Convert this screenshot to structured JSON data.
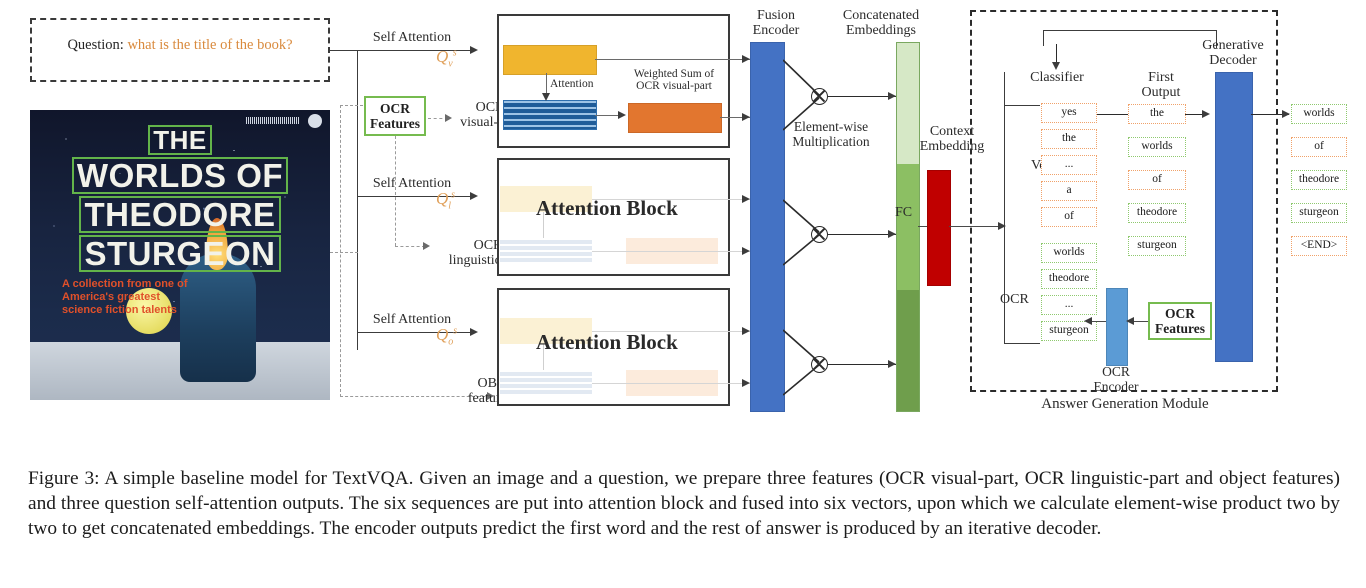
{
  "figure": {
    "question": {
      "lead": "Question:",
      "value": "what is the title of the book?"
    },
    "book_cover": {
      "title_lines": [
        "THE",
        "WORLDS OF",
        "THEODORE",
        "STURGEON"
      ],
      "subtitle": "A collection from one of\nAmerica's greatest\nscience fiction talents"
    },
    "branches": [
      {
        "self_attention": "Self\nAttention",
        "q_symbol": "Q",
        "q_sub": "v",
        "q_sup": "s",
        "feature_label": "OCR\nvisual-part"
      },
      {
        "self_attention": "Self\nAttention",
        "q_symbol": "Q",
        "q_sub": "l",
        "q_sup": "s",
        "feature_label": "OCR\nlinguistic-part"
      },
      {
        "self_attention": "Self\nAttention",
        "q_symbol": "Q",
        "q_sub": "o",
        "q_sup": "s",
        "feature_label": "OBJ\nfeatures"
      }
    ],
    "ocr_features_label": "OCR\nFeatures",
    "attention_panel": {
      "attention_label": "Attention",
      "weighted_sum_label": "Weighted Sum of\nOCR visual-part",
      "block_label": "Attention Block"
    },
    "fusion_encoder_label": "Fusion\nEncoder",
    "elementwise_label": "Element-wise\nMultiplication",
    "concatenated_label": "Concatenated\nEmbeddings",
    "context_embedding_label": "Context\nEmbedding",
    "fc_label": "FC",
    "answer_module": {
      "title": "Answer Generation Module",
      "classifier_label": "Classifier",
      "vocab_label": "Vocab",
      "ocr_label": "OCR",
      "first_output_label": "First\nOutput",
      "generative_decoder_label": "Generative\nDecoder",
      "ocr_encoder_label": "OCR\nEncoder",
      "ocr_features_label": "OCR\nFeatures",
      "classifier_vocab_tokens": [
        "yes",
        "the",
        "...",
        "a",
        "of"
      ],
      "classifier_ocr_tokens": [
        "worlds",
        "theodore",
        "...",
        "sturgeon"
      ],
      "first_output_tokens": [
        {
          "text": "the",
          "kind": "vocab"
        },
        {
          "text": "worlds",
          "kind": "ocr"
        },
        {
          "text": "of",
          "kind": "vocab"
        },
        {
          "text": "theodore",
          "kind": "ocr"
        },
        {
          "text": "sturgeon",
          "kind": "ocr"
        }
      ],
      "decoder_output_tokens": [
        {
          "text": "worlds",
          "kind": "ocr"
        },
        {
          "text": "of",
          "kind": "vocab"
        },
        {
          "text": "theodore",
          "kind": "ocr"
        },
        {
          "text": "sturgeon",
          "kind": "ocr"
        },
        {
          "text": "<END>",
          "kind": "vocab"
        }
      ]
    },
    "colors": {
      "question_value": "#d98a3d",
      "q_symbol": "#e0a05a",
      "ocr_feature_border": "#76bb4f",
      "gold": "#f0b52e",
      "stripe_blue": "#1f5c99",
      "orange": "#e2762f",
      "fusion_blue": "#4472c4",
      "green_light": "#d6e8c6",
      "green_mid": "#8cbf63",
      "green_dark": "#6f9e4c",
      "red": "#c00000",
      "encoder_blue": "#5b9bd5"
    }
  },
  "caption": {
    "text": "Figure 3: A simple baseline model for TextVQA. Given an image and a question, we prepare three features (OCR visual-part, OCR linguistic-part and object features) and three question self-attention outputs. The six sequences are put into attention block and fused into six vectors, upon which we calculate element-wise product two by two to get concatenated embeddings. The encoder outputs predict the first word and the rest of answer is produced by an iterative decoder."
  }
}
